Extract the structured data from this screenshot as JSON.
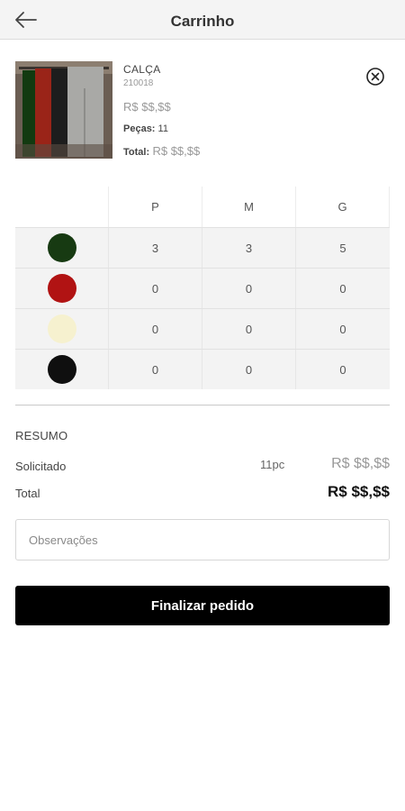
{
  "header": {
    "title": "Carrinho"
  },
  "product": {
    "name": "CALÇA",
    "code": "210018",
    "price": "R$ $$,$$",
    "pieces_label": "Peças:",
    "pieces_value": "11",
    "total_label": "Total:",
    "total_value": "R$ $$,$$"
  },
  "grid": {
    "sizes": [
      "P",
      "M",
      "G"
    ],
    "rows": [
      {
        "color": "#173a12",
        "values": [
          "3",
          "3",
          "5"
        ]
      },
      {
        "color": "#b11313",
        "values": [
          "0",
          "0",
          "0"
        ]
      },
      {
        "color": "#f6f1cf",
        "values": [
          "0",
          "0",
          "0"
        ]
      },
      {
        "color": "#0f0f0f",
        "values": [
          "0",
          "0",
          "0"
        ]
      }
    ]
  },
  "summary": {
    "title": "RESUMO",
    "requested_label": "Solicitado",
    "requested_qty": "11pc",
    "requested_price": "R$ $$,$$",
    "total_label": "Total",
    "total_price": "R$ $$,$$"
  },
  "observations": {
    "placeholder": "Observações"
  },
  "finish_button": {
    "label": "Finalizar pedido"
  },
  "icons": {
    "back": "arrow-left-icon",
    "remove": "close-circle-icon"
  }
}
